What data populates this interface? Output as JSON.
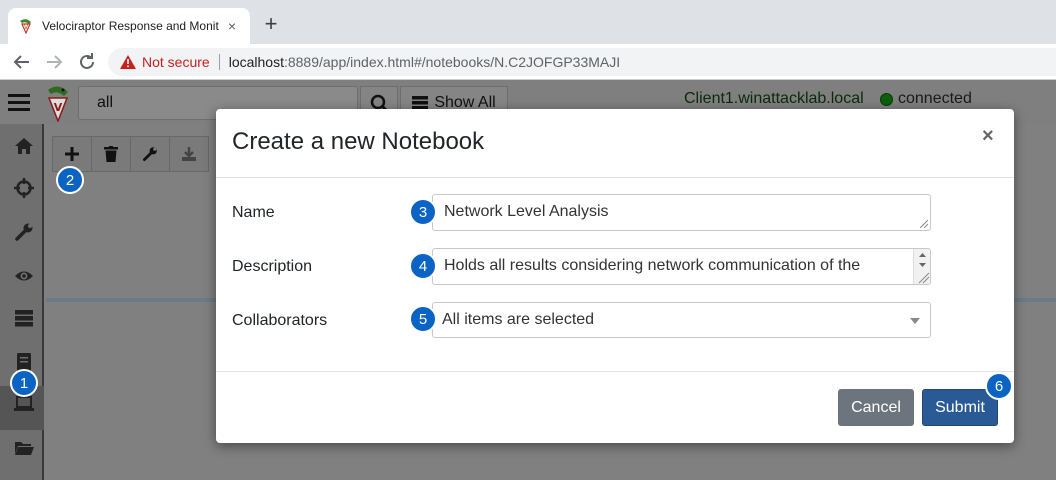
{
  "browser": {
    "tab_title": "Velociraptor Response and Monit",
    "new_tab_label": "+",
    "security_label": "Not secure",
    "url_host": "localhost",
    "url_rest": ":8889/app/index.html#/notebooks/N.C2JOFGP33MAJI"
  },
  "navbar": {
    "search_value": "all",
    "show_all_label": "Show All",
    "client_name": "Client1.winattacklab.local",
    "connection_status": "connected"
  },
  "sidebar": {
    "icons": [
      "home-icon",
      "crosshair-icon",
      "wrench-icon",
      "eye-icon",
      "server-icon",
      "notebook-icon",
      "laptop-icon",
      "folder-open-icon"
    ]
  },
  "notebook_toolbar": {
    "icons": [
      "plus-icon",
      "trash-icon",
      "wrench-icon",
      "download-icon"
    ]
  },
  "modal": {
    "title": "Create a new Notebook",
    "close_symbol": "×",
    "name_label": "Name",
    "name_value": "Network Level Analysis",
    "description_label": "Description",
    "description_value": "Holds all results considering network communication of the",
    "collaborators_label": "Collaborators",
    "collaborators_value": "All items are selected",
    "cancel_label": "Cancel",
    "submit_label": "Submit"
  },
  "callouts": [
    "1",
    "2",
    "3",
    "4",
    "5",
    "6"
  ],
  "colors": {
    "callout": "#0b63c4",
    "submit": "#2a5a96",
    "cancel": "#6c757d",
    "not_secure": "#c5221f"
  }
}
